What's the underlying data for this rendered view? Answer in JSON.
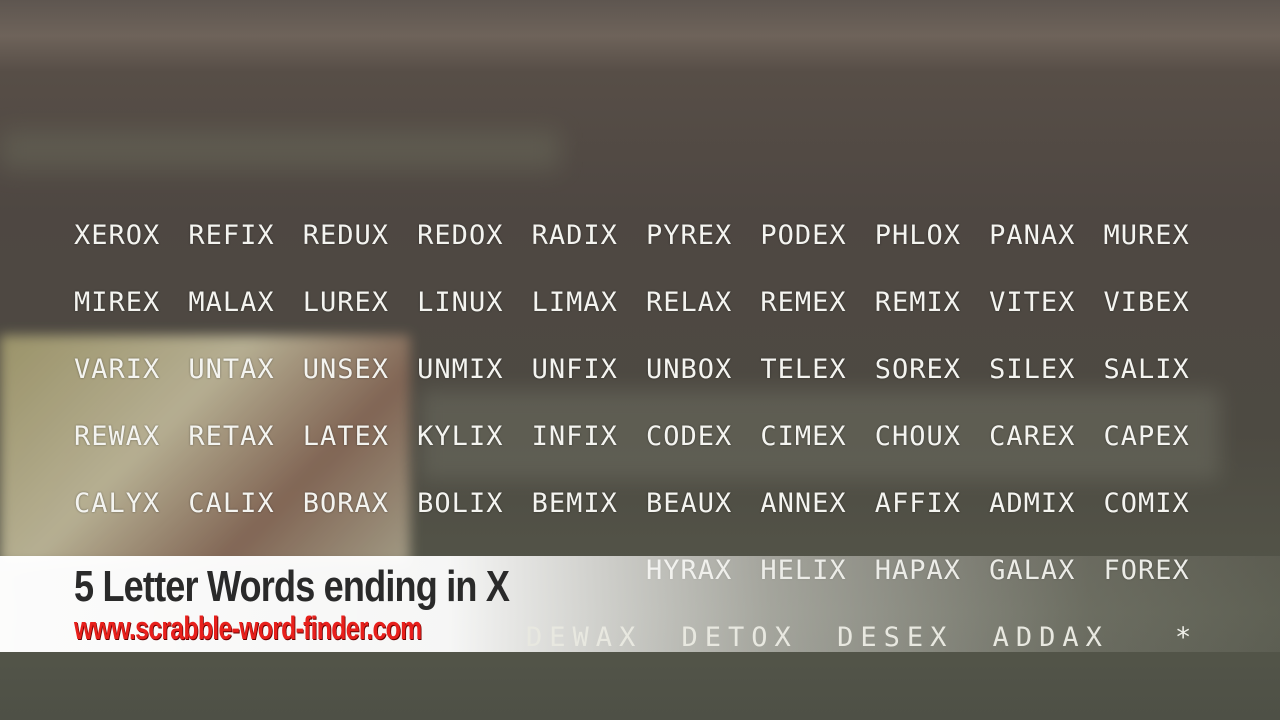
{
  "rows": [
    [
      "XEROX",
      "REFIX",
      "REDUX",
      "REDOX",
      "RADIX",
      "PYREX",
      "PODEX",
      "PHLOX",
      "PANAX",
      "MUREX"
    ],
    [
      "MIREX",
      "MALAX",
      "LUREX",
      "LINUX",
      "LIMAX",
      "RELAX",
      "REMEX",
      "REMIX",
      "VITEX",
      "VIBEX"
    ],
    [
      "VARIX",
      "UNTAX",
      "UNSEX",
      "UNMIX",
      "UNFIX",
      "UNBOX",
      "TELEX",
      "SOREX",
      "SILEX",
      "SALIX"
    ],
    [
      "REWAX",
      "RETAX",
      "LATEX",
      "KYLIX",
      "INFIX",
      "CODEX",
      "CIMEX",
      "CHOUX",
      "CAREX",
      "CAPEX"
    ],
    [
      "CALYX",
      "CALIX",
      "BORAX",
      "BOLIX",
      "BEMIX",
      "BEAUX",
      "ANNEX",
      "AFFIX",
      "ADMIX",
      "COMIX"
    ],
    [
      "",
      "",
      "",
      "",
      "",
      "HYRAX",
      "HELIX",
      "HAPAX",
      "GALAX",
      "FOREX"
    ]
  ],
  "last_row": "DEWAX DETOX DESEX ADDAX",
  "asterisk": "*",
  "banner": {
    "title": "5 Letter Words ending in X",
    "url": "www.scrabble-word-finder.com",
    "url_color": "#e8201c"
  }
}
